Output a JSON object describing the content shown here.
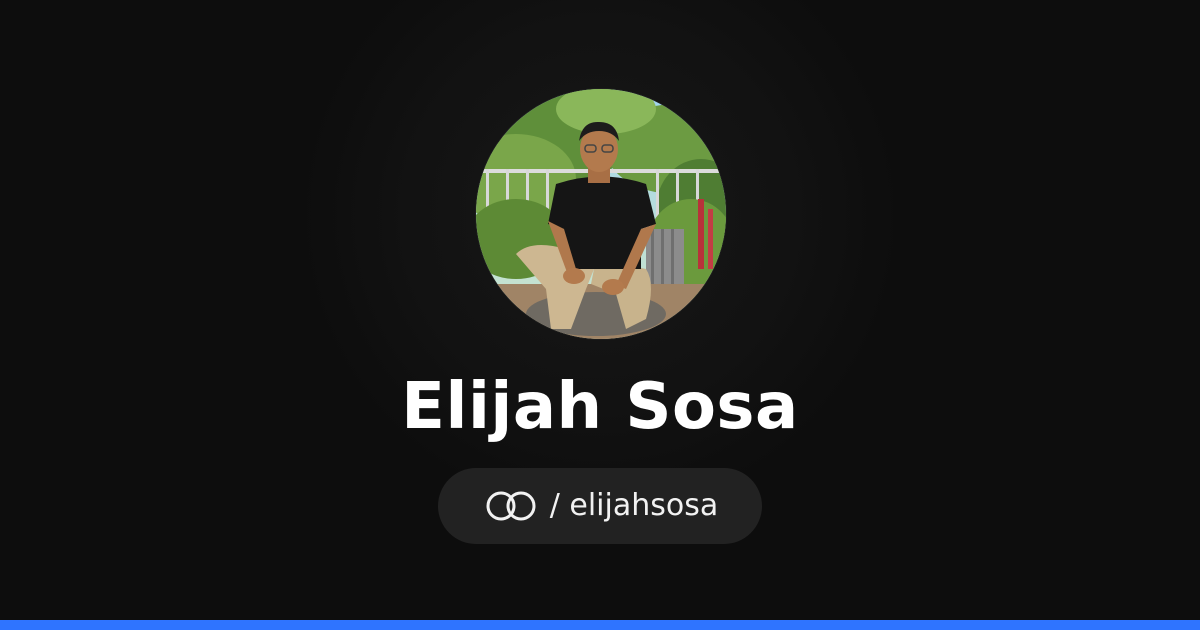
{
  "profile": {
    "name": "Elijah Sosa",
    "handle": "/ elijahsosa",
    "avatar_icon": "profile-photo",
    "logo_icon": "linked-rings-icon"
  },
  "colors": {
    "background": "#0d0d0d",
    "pill_background": "#222222",
    "text": "#ffffff",
    "accent": "#2f74ff"
  }
}
